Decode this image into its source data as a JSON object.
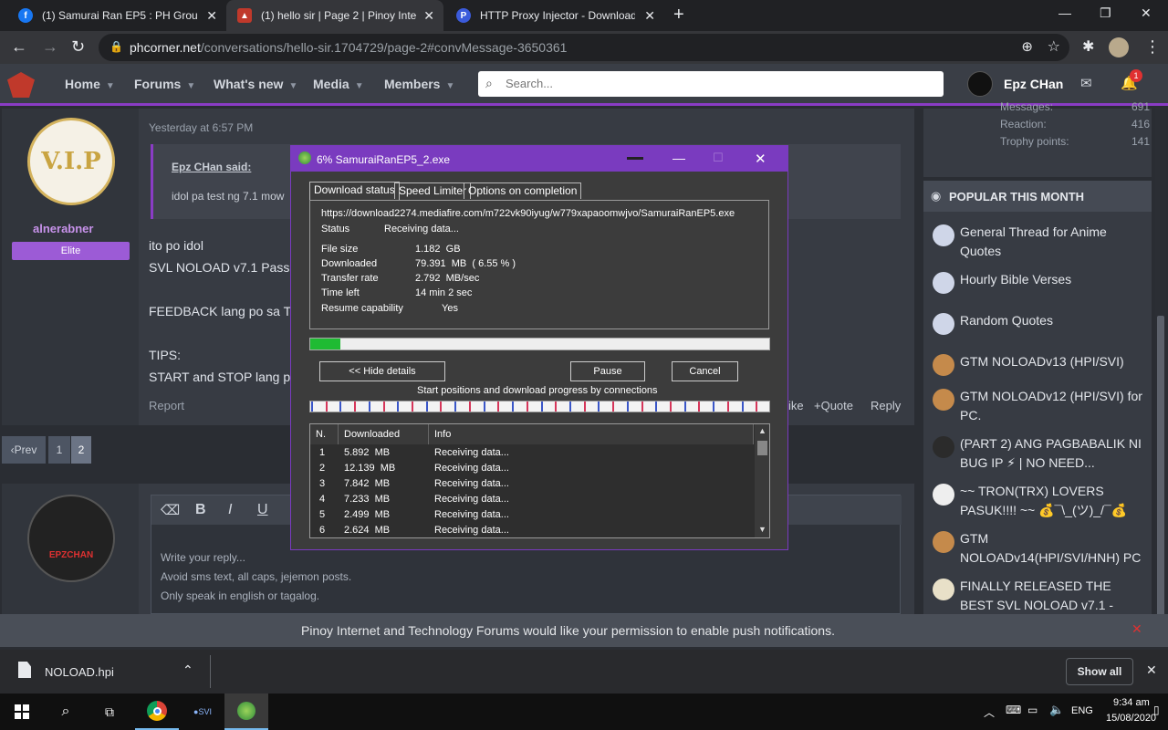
{
  "browser": {
    "tabs": [
      {
        "title": "(1) Samurai Ran EP5 : PH Group |",
        "icon": "facebook-icon"
      },
      {
        "title": "(1) hello sir | Page 2 | Pinoy Intern",
        "icon": "phcorner-icon"
      },
      {
        "title": "HTTP Proxy Injector - Download",
        "icon": "proxy-icon"
      }
    ],
    "url_domain": "phcorner.net",
    "url_path": "/conversations/hello-sir.1704729/page-2#convMessage-3650361"
  },
  "site_nav": {
    "items": [
      "Home",
      "Forums",
      "What's new",
      "Media",
      "Members"
    ],
    "search_placeholder": "Search...",
    "username": "Epz CHan",
    "notif_count": "1"
  },
  "stats": {
    "rows": [
      {
        "label": "Messages:",
        "value": "691"
      },
      {
        "label": "Reaction:",
        "value": "416"
      },
      {
        "label": "Trophy points:",
        "value": "141"
      }
    ]
  },
  "message": {
    "timestamp": "Yesterday at 6:57 PM",
    "quote_author": "Epz CHan said:",
    "quote_text": "idol pa test ng 7.1 mow",
    "author": "alnerabner",
    "role": "Elite",
    "lines": [
      "ito po idol",
      "SVL NOLOAD v7.1 Pass",
      "",
      "FEEDBACK lang po sa T",
      "",
      "TIPS:",
      "START and STOP lang p"
    ],
    "report": "Report",
    "like": "ike",
    "quote_btn": "+Quote",
    "reply_btn": "Reply"
  },
  "pagination": {
    "prev": "Prev",
    "pages": [
      "1",
      "2"
    ]
  },
  "editor": {
    "placeholder_lines": [
      "Write your reply...",
      "Avoid sms text, all caps, jejemon posts.",
      "Only speak in english or tagalog."
    ],
    "toolbar_glyphs": [
      "⌫",
      "B",
      "I",
      "U"
    ]
  },
  "popular": {
    "heading": "POPULAR THIS MONTH",
    "items": [
      "General Thread for Anime Quotes",
      "Hourly Bible Verses",
      "Random Quotes",
      "GTM NOLOADv13 (HPI/SVI)",
      "GTM NOLOADv12 (HPI/SVI) for PC.",
      "(PART 2) ANG PAGBABALIK NI BUG IP ⚡ | NO NEED...",
      "~~ TRON(TRX) LOVERS PASUK!!!! ~~ 💰¯\\_(ツ)_/¯💰",
      "GTM NOLOADv14(HPI/SVI/HNH) PC",
      "FINALLY RELEASED THE BEST SVL NOLOAD v7.1 -"
    ]
  },
  "dialog": {
    "title": "6% SamuraiRanEP5_2.exe",
    "tabs": [
      "Download status",
      "Speed Limiter",
      "Options on completion"
    ],
    "url": "https://download2274.mediafire.com/m722vk90iyug/w779xapaoomwjvo/SamuraiRanEP5.exe",
    "status_label": "Status",
    "status_value": "Receiving data...",
    "fields": [
      {
        "label": "File size",
        "value": "1.182  GB"
      },
      {
        "label": "Downloaded",
        "value": "79.391  MB  ( 6.55 % )"
      },
      {
        "label": "Transfer rate",
        "value": "2.792  MB/sec"
      },
      {
        "label": "Time left",
        "value": "14 min 2 sec"
      },
      {
        "label": "Resume capability",
        "value": "Yes"
      }
    ],
    "progress": 0.0655,
    "hide_details": "<< Hide details",
    "pause": "Pause",
    "cancel": "Cancel",
    "connections_caption": "Start positions and download progress by connections",
    "columns": [
      "N.",
      "Downloaded",
      "Info"
    ],
    "connections": [
      {
        "n": "1",
        "downloaded": "5.892  MB",
        "info": "Receiving data..."
      },
      {
        "n": "2",
        "downloaded": "12.139  MB",
        "info": "Receiving data..."
      },
      {
        "n": "3",
        "downloaded": "7.842  MB",
        "info": "Receiving data..."
      },
      {
        "n": "4",
        "downloaded": "7.233  MB",
        "info": "Receiving data..."
      },
      {
        "n": "5",
        "downloaded": "2.499  MB",
        "info": "Receiving data..."
      },
      {
        "n": "6",
        "downloaded": "2.624  MB",
        "info": "Receiving data..."
      }
    ]
  },
  "push_notice": "Pinoy Internet and Technology Forums would like your permission to enable push notifications.",
  "downloads": {
    "file": "NOLOAD.hpi",
    "show_all": "Show all"
  },
  "taskbar": {
    "lang": "ENG",
    "time": "9:34 am",
    "date": "15/08/2020"
  }
}
